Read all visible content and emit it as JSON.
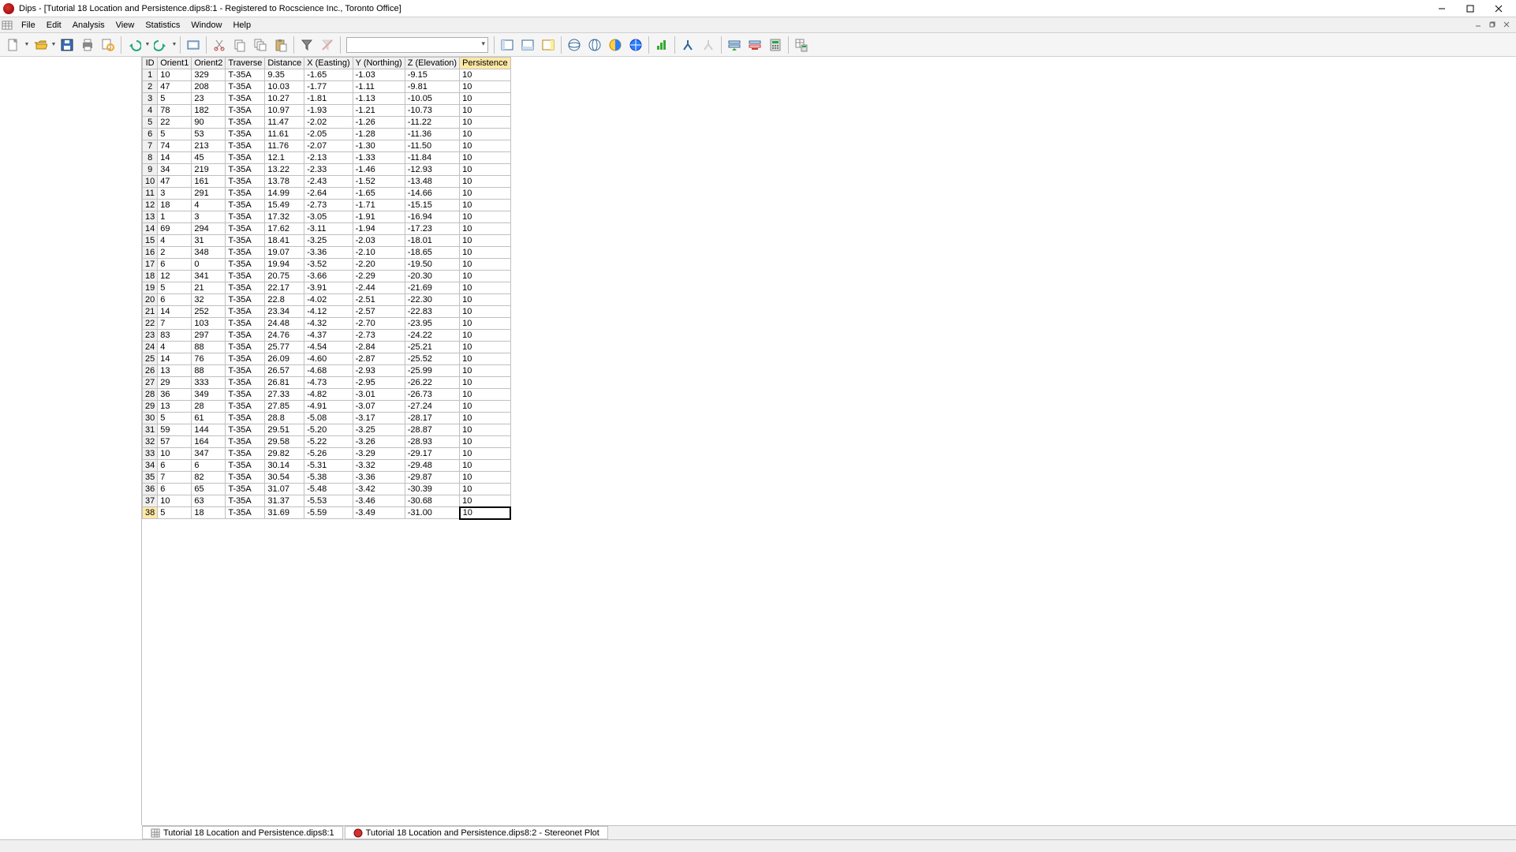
{
  "title": "Dips - [Tutorial 18 Location and Persistence.dips8:1 - Registered to Rocscience Inc., Toronto Office]",
  "menu": [
    "File",
    "Edit",
    "Analysis",
    "View",
    "Statistics",
    "Window",
    "Help"
  ],
  "tabs": [
    {
      "label": "Tutorial 18 Location and Persistence.dips8:1",
      "icon": "grid"
    },
    {
      "label": "Tutorial 18 Location and Persistence.dips8:2 - Stereonet Plot",
      "icon": "stereo"
    }
  ],
  "columns": [
    "ID",
    "Orient1",
    "Orient2",
    "Traverse",
    "Distance",
    "X (Easting)",
    "Y (Northing)",
    "Z (Elevation)",
    "Persistence"
  ],
  "selected_column_index": 8,
  "selected_row_index": 37,
  "rows": [
    [
      "1",
      "10",
      "329",
      "T-35A",
      "9.35",
      "-1.65",
      "-1.03",
      "-9.15",
      "10"
    ],
    [
      "2",
      "47",
      "208",
      "T-35A",
      "10.03",
      "-1.77",
      "-1.11",
      "-9.81",
      "10"
    ],
    [
      "3",
      "5",
      "23",
      "T-35A",
      "10.27",
      "-1.81",
      "-1.13",
      "-10.05",
      "10"
    ],
    [
      "4",
      "78",
      "182",
      "T-35A",
      "10.97",
      "-1.93",
      "-1.21",
      "-10.73",
      "10"
    ],
    [
      "5",
      "22",
      "90",
      "T-35A",
      "11.47",
      "-2.02",
      "-1.26",
      "-11.22",
      "10"
    ],
    [
      "6",
      "5",
      "53",
      "T-35A",
      "11.61",
      "-2.05",
      "-1.28",
      "-11.36",
      "10"
    ],
    [
      "7",
      "74",
      "213",
      "T-35A",
      "11.76",
      "-2.07",
      "-1.30",
      "-11.50",
      "10"
    ],
    [
      "8",
      "14",
      "45",
      "T-35A",
      "12.1",
      "-2.13",
      "-1.33",
      "-11.84",
      "10"
    ],
    [
      "9",
      "34",
      "219",
      "T-35A",
      "13.22",
      "-2.33",
      "-1.46",
      "-12.93",
      "10"
    ],
    [
      "10",
      "47",
      "161",
      "T-35A",
      "13.78",
      "-2.43",
      "-1.52",
      "-13.48",
      "10"
    ],
    [
      "11",
      "3",
      "291",
      "T-35A",
      "14.99",
      "-2.64",
      "-1.65",
      "-14.66",
      "10"
    ],
    [
      "12",
      "18",
      "4",
      "T-35A",
      "15.49",
      "-2.73",
      "-1.71",
      "-15.15",
      "10"
    ],
    [
      "13",
      "1",
      "3",
      "T-35A",
      "17.32",
      "-3.05",
      "-1.91",
      "-16.94",
      "10"
    ],
    [
      "14",
      "69",
      "294",
      "T-35A",
      "17.62",
      "-3.11",
      "-1.94",
      "-17.23",
      "10"
    ],
    [
      "15",
      "4",
      "31",
      "T-35A",
      "18.41",
      "-3.25",
      "-2.03",
      "-18.01",
      "10"
    ],
    [
      "16",
      "2",
      "348",
      "T-35A",
      "19.07",
      "-3.36",
      "-2.10",
      "-18.65",
      "10"
    ],
    [
      "17",
      "6",
      "0",
      "T-35A",
      "19.94",
      "-3.52",
      "-2.20",
      "-19.50",
      "10"
    ],
    [
      "18",
      "12",
      "341",
      "T-35A",
      "20.75",
      "-3.66",
      "-2.29",
      "-20.30",
      "10"
    ],
    [
      "19",
      "5",
      "21",
      "T-35A",
      "22.17",
      "-3.91",
      "-2.44",
      "-21.69",
      "10"
    ],
    [
      "20",
      "6",
      "32",
      "T-35A",
      "22.8",
      "-4.02",
      "-2.51",
      "-22.30",
      "10"
    ],
    [
      "21",
      "14",
      "252",
      "T-35A",
      "23.34",
      "-4.12",
      "-2.57",
      "-22.83",
      "10"
    ],
    [
      "22",
      "7",
      "103",
      "T-35A",
      "24.48",
      "-4.32",
      "-2.70",
      "-23.95",
      "10"
    ],
    [
      "23",
      "83",
      "297",
      "T-35A",
      "24.76",
      "-4.37",
      "-2.73",
      "-24.22",
      "10"
    ],
    [
      "24",
      "4",
      "88",
      "T-35A",
      "25.77",
      "-4.54",
      "-2.84",
      "-25.21",
      "10"
    ],
    [
      "25",
      "14",
      "76",
      "T-35A",
      "26.09",
      "-4.60",
      "-2.87",
      "-25.52",
      "10"
    ],
    [
      "26",
      "13",
      "88",
      "T-35A",
      "26.57",
      "-4.68",
      "-2.93",
      "-25.99",
      "10"
    ],
    [
      "27",
      "29",
      "333",
      "T-35A",
      "26.81",
      "-4.73",
      "-2.95",
      "-26.22",
      "10"
    ],
    [
      "28",
      "36",
      "349",
      "T-35A",
      "27.33",
      "-4.82",
      "-3.01",
      "-26.73",
      "10"
    ],
    [
      "29",
      "13",
      "28",
      "T-35A",
      "27.85",
      "-4.91",
      "-3.07",
      "-27.24",
      "10"
    ],
    [
      "30",
      "5",
      "61",
      "T-35A",
      "28.8",
      "-5.08",
      "-3.17",
      "-28.17",
      "10"
    ],
    [
      "31",
      "59",
      "144",
      "T-35A",
      "29.51",
      "-5.20",
      "-3.25",
      "-28.87",
      "10"
    ],
    [
      "32",
      "57",
      "164",
      "T-35A",
      "29.58",
      "-5.22",
      "-3.26",
      "-28.93",
      "10"
    ],
    [
      "33",
      "10",
      "347",
      "T-35A",
      "29.82",
      "-5.26",
      "-3.29",
      "-29.17",
      "10"
    ],
    [
      "34",
      "6",
      "6",
      "T-35A",
      "30.14",
      "-5.31",
      "-3.32",
      "-29.48",
      "10"
    ],
    [
      "35",
      "7",
      "82",
      "T-35A",
      "30.54",
      "-5.38",
      "-3.36",
      "-29.87",
      "10"
    ],
    [
      "36",
      "6",
      "65",
      "T-35A",
      "31.07",
      "-5.48",
      "-3.42",
      "-30.39",
      "10"
    ],
    [
      "37",
      "10",
      "63",
      "T-35A",
      "31.37",
      "-5.53",
      "-3.46",
      "-30.68",
      "10"
    ],
    [
      "38",
      "5",
      "18",
      "T-35A",
      "31.69",
      "-5.59",
      "-3.49",
      "-31.00",
      "10"
    ]
  ],
  "toolbar_icons": [
    {
      "name": "new-icon",
      "dd": true
    },
    {
      "name": "open-icon",
      "dd": true
    },
    {
      "name": "save-icon"
    },
    {
      "name": "print-icon"
    },
    {
      "name": "print-preview-icon"
    },
    "sep",
    {
      "name": "undo-icon",
      "dd": true
    },
    {
      "name": "redo-icon",
      "dd": true
    },
    "sep",
    {
      "name": "screenshot-icon"
    },
    "sep",
    {
      "name": "cut-icon"
    },
    {
      "name": "copy-icon"
    },
    {
      "name": "copy-all-icon"
    },
    {
      "name": "paste-icon"
    },
    "sep",
    {
      "name": "filter-icon"
    },
    {
      "name": "filter-clear-icon",
      "disabled": true
    },
    "sep",
    "combo",
    "sep",
    {
      "name": "sidebar-left-icon"
    },
    {
      "name": "sidebar-bottom-icon"
    },
    {
      "name": "sidebar-right-icon"
    },
    "sep",
    {
      "name": "globe1-icon"
    },
    {
      "name": "globe2-icon"
    },
    {
      "name": "globe-color-icon"
    },
    {
      "name": "globe-grid-icon"
    },
    "sep",
    {
      "name": "chart-icon"
    },
    "sep",
    {
      "name": "fork-icon"
    },
    {
      "name": "fork2-icon",
      "disabled": true
    },
    "sep",
    {
      "name": "insert-row-icon"
    },
    {
      "name": "delete-row-icon"
    },
    {
      "name": "calc-icon"
    },
    "sep",
    {
      "name": "table-calc-icon"
    }
  ]
}
